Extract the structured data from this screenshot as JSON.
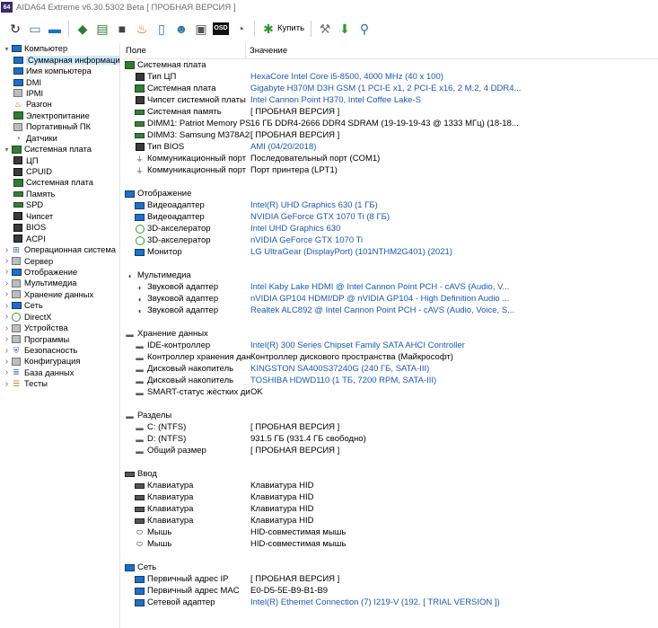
{
  "titlebar": {
    "badge": "64",
    "title": "AIDA64 Extreme v6.30.5302 Beta  [ ПРОБНАЯ ВЕРСИЯ ]"
  },
  "toolbar": {
    "buttons": [
      {
        "name": "refresh-icon",
        "glyph": "↻",
        "color": "#222222"
      },
      {
        "name": "report-icon",
        "glyph": "▭",
        "color": "#3b6fc2"
      },
      {
        "name": "computer-icon",
        "glyph": "▬",
        "color": "#1f6fc7"
      },
      {
        "name": "motherboard-icon",
        "glyph": "◆",
        "color": "#2e7d32"
      },
      {
        "name": "memory-icon",
        "glyph": "▤",
        "color": "#2e7d32"
      },
      {
        "name": "cpu-icon",
        "glyph": "■",
        "color": "#444444"
      },
      {
        "name": "flame-icon",
        "glyph": "♨",
        "color": "#e65100"
      },
      {
        "name": "device-icon",
        "glyph": "▯",
        "color": "#2a6ab0"
      },
      {
        "name": "user-icon",
        "glyph": "☻",
        "color": "#2b7a9b"
      },
      {
        "name": "clipboard-icon",
        "glyph": "▣",
        "color": "#555555"
      },
      {
        "name": "osd-icon",
        "glyph": "OSD",
        "color": "#111111"
      },
      {
        "name": "gauge-icon",
        "glyph": "◔",
        "color": "#2e7d32"
      }
    ],
    "buy_label": "Купить",
    "extra": [
      {
        "name": "tools-icon",
        "glyph": "⚒",
        "color": "#777777"
      },
      {
        "name": "download-icon",
        "glyph": "⬇",
        "color": "#2e9b2e"
      },
      {
        "name": "search-icon",
        "glyph": "⚲",
        "color": "#2a6ab0"
      }
    ]
  },
  "tree": {
    "nodes": [
      {
        "name": "tree-computer",
        "level": 0,
        "expander": "⌄",
        "icon": "ic-mon",
        "label": "Компьютер"
      },
      {
        "name": "tree-summary",
        "level": 1,
        "expander": "",
        "icon": "ic-mon",
        "label": "Суммарная информация",
        "selected": true
      },
      {
        "name": "tree-computer-name",
        "level": 1,
        "expander": "",
        "icon": "ic-mon",
        "label": "Имя компьютера"
      },
      {
        "name": "tree-dmi",
        "level": 1,
        "expander": "",
        "icon": "ic-mon",
        "label": "DMI"
      },
      {
        "name": "tree-ipmi",
        "level": 1,
        "expander": "",
        "icon": "ic-gray",
        "label": "IPMI"
      },
      {
        "name": "tree-overclock",
        "level": 1,
        "expander": "",
        "icon": "flame",
        "label": "Разгон"
      },
      {
        "name": "tree-power",
        "level": 1,
        "expander": "",
        "icon": "ic-board",
        "label": "Электропитание"
      },
      {
        "name": "tree-portable-pc",
        "level": 1,
        "expander": "",
        "icon": "ic-gray",
        "label": "Портативный ПК"
      },
      {
        "name": "tree-sensors",
        "level": 1,
        "expander": "",
        "icon": "gauge",
        "label": "Датчики"
      },
      {
        "name": "tree-motherboard",
        "level": 0,
        "expander": "⌄",
        "icon": "ic-board",
        "label": "Системная плата"
      },
      {
        "name": "tree-cpu",
        "level": 1,
        "expander": "",
        "icon": "ic-chip",
        "label": "ЦП"
      },
      {
        "name": "tree-cpuid",
        "level": 1,
        "expander": "",
        "icon": "ic-chip",
        "label": "CPUID"
      },
      {
        "name": "tree-mb",
        "level": 1,
        "expander": "",
        "icon": "ic-board",
        "label": "Системная плата"
      },
      {
        "name": "tree-memory",
        "level": 1,
        "expander": "",
        "icon": "ic-ram",
        "label": "Память"
      },
      {
        "name": "tree-spd",
        "level": 1,
        "expander": "",
        "icon": "ic-ram",
        "label": "SPD"
      },
      {
        "name": "tree-chipset",
        "level": 1,
        "expander": "",
        "icon": "ic-chip",
        "label": "Чипсет"
      },
      {
        "name": "tree-bios",
        "level": 1,
        "expander": "",
        "icon": "ic-chip",
        "label": "BIOS"
      },
      {
        "name": "tree-acpi",
        "level": 1,
        "expander": "",
        "icon": "ic-chip",
        "label": "ACPI"
      },
      {
        "name": "tree-os",
        "level": 0,
        "expander": "›",
        "icon": "win",
        "label": "Операционная система"
      },
      {
        "name": "tree-server",
        "level": 0,
        "expander": "›",
        "icon": "ic-gray",
        "label": "Сервер"
      },
      {
        "name": "tree-display",
        "level": 0,
        "expander": "›",
        "icon": "ic-mon",
        "label": "Отображение"
      },
      {
        "name": "tree-multimedia",
        "level": 0,
        "expander": "›",
        "icon": "ic-gray",
        "label": "Мультимедиа"
      },
      {
        "name": "tree-storage",
        "level": 0,
        "expander": "›",
        "icon": "ic-gray",
        "label": "Хранение данных"
      },
      {
        "name": "tree-network",
        "level": 0,
        "expander": "›",
        "icon": "ic-mon",
        "label": "Сеть"
      },
      {
        "name": "tree-directx",
        "level": 0,
        "expander": "›",
        "icon": "xbox",
        "label": "DirectX"
      },
      {
        "name": "tree-devices",
        "level": 0,
        "expander": "›",
        "icon": "ic-gray",
        "label": "Устройства"
      },
      {
        "name": "tree-programs",
        "level": 0,
        "expander": "›",
        "icon": "ic-gray",
        "label": "Программы"
      },
      {
        "name": "tree-security",
        "level": 0,
        "expander": "›",
        "icon": "shield",
        "label": "Безопасность"
      },
      {
        "name": "tree-config",
        "level": 0,
        "expander": "›",
        "icon": "ic-gray",
        "label": "Конфигурация"
      },
      {
        "name": "tree-database",
        "level": 0,
        "expander": "›",
        "icon": "db",
        "label": "База данных"
      },
      {
        "name": "tree-tests",
        "level": 0,
        "expander": "›",
        "icon": "tests",
        "label": "Тесты"
      }
    ]
  },
  "grid": {
    "header": {
      "field": "Поле",
      "value": "Значение"
    },
    "sections": [
      {
        "name": "section-motherboard",
        "icon": "ic-board",
        "title": "Системная плата",
        "rows": [
          {
            "icon": "ic-chip",
            "field": "Тип ЦП",
            "value": "HexaCore Intel Core i5-8500, 4000 MHz (40 x 100)",
            "link": true
          },
          {
            "icon": "ic-board",
            "field": "Системная плата",
            "value": "Gigabyte H370M D3H GSM  (1 PCI-E x1, 2 PCI-E x16, 2 M.2, 4 DDR4...",
            "link": true
          },
          {
            "icon": "ic-chip",
            "field": "Чипсет системной платы",
            "value": "Intel Cannon Point H370, Intel Coffee Lake-S",
            "link": true
          },
          {
            "icon": "ic-ram",
            "field": "Системная память",
            "value": "[ ПРОБНАЯ ВЕРСИЯ ]",
            "link": false
          },
          {
            "icon": "ic-ram",
            "field": "DIMM1: Patriot Memory PS...",
            "value": "16 ГБ DDR4-2666 DDR4 SDRAM  (19-19-19-43 @ 1333 МГц)  (18-18...",
            "link": false
          },
          {
            "icon": "ic-ram",
            "field": "DIMM3: Samsung M378A2K...",
            "value": "[ ПРОБНАЯ ВЕРСИЯ ]",
            "link": false
          },
          {
            "icon": "ic-chip",
            "field": "Тип BIOS",
            "value": "AMI (04/20/2018)",
            "link": true
          },
          {
            "icon": "plug",
            "field": "Коммуникационный порт",
            "value": "Последовательный порт (COM1)",
            "link": false
          },
          {
            "icon": "plug",
            "field": "Коммуникационный порт",
            "value": "Порт принтера (LPT1)",
            "link": false
          }
        ]
      },
      {
        "name": "section-display",
        "icon": "ic-mon",
        "title": "Отображение",
        "rows": [
          {
            "icon": "ic-mon",
            "field": "Видеоадаптер",
            "value": "Intel(R) UHD Graphics 630  (1 ГБ)",
            "link": true
          },
          {
            "icon": "ic-mon",
            "field": "Видеоадаптер",
            "value": "NVIDIA GeForce GTX 1070 Ti  (8 ГБ)",
            "link": true
          },
          {
            "icon": "xbox",
            "field": "3D-акселератор",
            "value": "Intel UHD Graphics 630",
            "link": true
          },
          {
            "icon": "xbox",
            "field": "3D-акселератор",
            "value": "nVIDIA GeForce GTX 1070 Ti",
            "link": true
          },
          {
            "icon": "ic-mon",
            "field": "Монитор",
            "value": "LG UltraGear (DisplayPort)  (101NTHM2G401)  (2021)",
            "link": true
          }
        ]
      },
      {
        "name": "section-multimedia",
        "icon": "speaker",
        "title": "Мультимедиа",
        "rows": [
          {
            "icon": "speaker",
            "field": "Звуковой адаптер",
            "value": "Intel Kaby Lake HDMI @ Intel Cannon Point PCH - cAVS (Audio, V...",
            "link": true
          },
          {
            "icon": "speaker",
            "field": "Звуковой адаптер",
            "value": "nVIDIA GP104 HDMI/DP @ nVIDIA GP104 - High Definition Audio ...",
            "link": true
          },
          {
            "icon": "speaker",
            "field": "Звуковой адаптер",
            "value": "Realtek ALC892 @ Intel Cannon Point PCH - cAVS (Audio, Voice, S...",
            "link": true
          }
        ]
      },
      {
        "name": "section-storage",
        "icon": "disk",
        "title": "Хранение данных",
        "rows": [
          {
            "icon": "disk",
            "field": "IDE-контроллер",
            "value": "Intel(R) 300 Series Chipset Family SATA AHCI Controller",
            "link": true
          },
          {
            "icon": "disk",
            "field": "Контроллер хранения дан...",
            "value": "Контроллер дискового пространства (Майкрософт)",
            "link": false
          },
          {
            "icon": "disk",
            "field": "Дисковый накопитель",
            "value": "KINGSTON SA400S37240G  (240 ГБ, SATA-III)",
            "link": true
          },
          {
            "icon": "disk",
            "field": "Дисковый накопитель",
            "value": "TOSHIBA HDWD110  (1 ТБ, 7200 RPM, SATA-III)",
            "link": true
          },
          {
            "icon": "disk",
            "field": "SMART-статус жёстких дис...",
            "value": "OK",
            "link": false
          }
        ]
      },
      {
        "name": "section-partitions",
        "icon": "disk",
        "title": "Разделы",
        "rows": [
          {
            "icon": "disk",
            "field": "C: (NTFS)",
            "value": "[ ПРОБНАЯ ВЕРСИЯ ]",
            "link": false
          },
          {
            "icon": "disk",
            "field": "D: (NTFS)",
            "value": "931.5 ГБ (931.4 ГБ свободно)",
            "link": false
          },
          {
            "icon": "disk",
            "field": "Общий размер",
            "value": "[ ПРОБНАЯ ВЕРСИЯ ]",
            "link": false
          }
        ]
      },
      {
        "name": "section-input",
        "icon": "ic-kbd",
        "title": "Ввод",
        "rows": [
          {
            "icon": "ic-kbd",
            "field": "Клавиатура",
            "value": "Клавиатура HID",
            "link": false
          },
          {
            "icon": "ic-kbd",
            "field": "Клавиатура",
            "value": "Клавиатура HID",
            "link": false
          },
          {
            "icon": "ic-kbd",
            "field": "Клавиатура",
            "value": "Клавиатура HID",
            "link": false
          },
          {
            "icon": "ic-kbd",
            "field": "Клавиатура",
            "value": "Клавиатура HID",
            "link": false
          },
          {
            "icon": "mouse",
            "field": "Мышь",
            "value": "HID-совместимая мышь",
            "link": false
          },
          {
            "icon": "mouse",
            "field": "Мышь",
            "value": "HID-совместимая мышь",
            "link": false
          }
        ]
      },
      {
        "name": "section-network",
        "icon": "ic-mon",
        "title": "Сеть",
        "rows": [
          {
            "icon": "ic-mon",
            "field": "Первичный адрес IP",
            "value": "[ ПРОБНАЯ ВЕРСИЯ ]",
            "link": false
          },
          {
            "icon": "ic-mon",
            "field": "Первичный адрес MAC",
            "value": "E0-D5-5E-B9-B1-B9",
            "link": false
          },
          {
            "icon": "ic-mon",
            "field": "Сетевой адаптер",
            "value": "Intel(R) Ethernet Connection (7) I219-V  (192. [ TRIAL VERSION ])",
            "link": true
          }
        ]
      }
    ]
  }
}
